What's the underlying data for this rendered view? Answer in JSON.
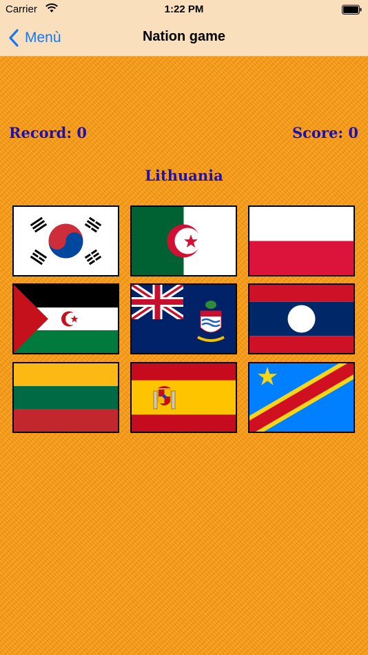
{
  "status_bar": {
    "carrier": "Carrier",
    "time": "1:22 PM"
  },
  "nav": {
    "back_label": "Menù",
    "title": "Nation game"
  },
  "game": {
    "record_text": "Record: 0",
    "score_text": "Score: 0",
    "target_country": "Lithuania"
  },
  "flags": [
    "south-korea-flag",
    "algeria-flag",
    "poland-flag",
    "western-sahara-flag",
    "cayman-islands-flag",
    "laos-flag",
    "lithuania-flag",
    "spain-flag",
    "dr-congo-flag"
  ],
  "colors": {
    "nav_bg": "#f9dfbc",
    "background": "#fb9c14",
    "text": "#1f10b0",
    "link": "#1777f2"
  }
}
